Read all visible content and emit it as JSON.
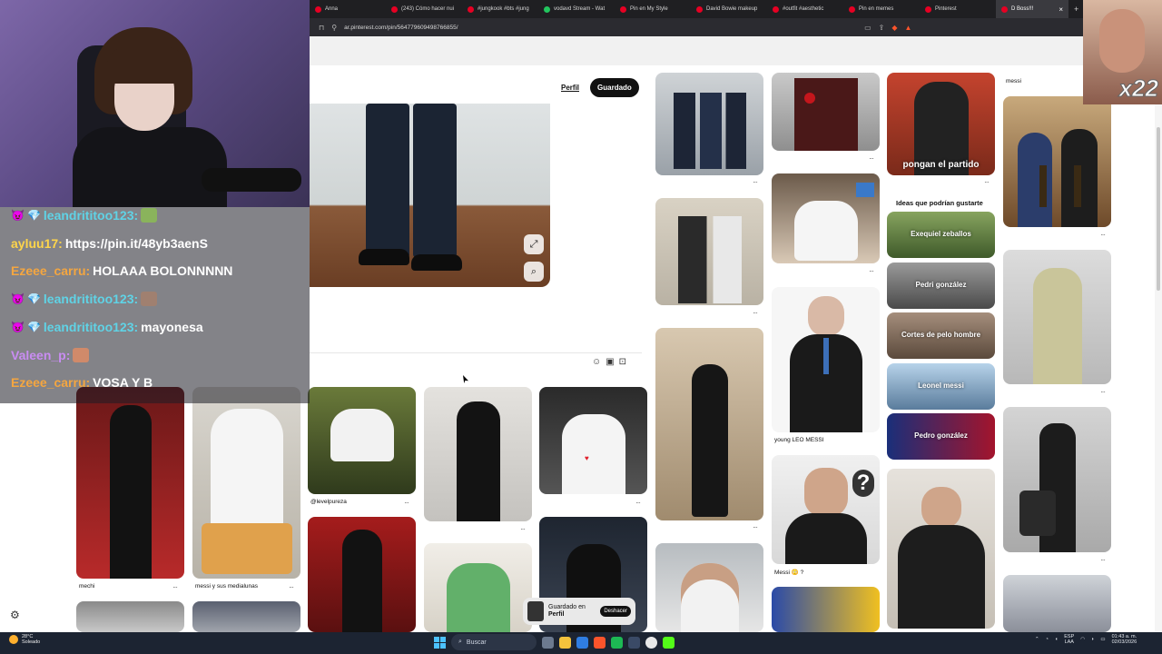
{
  "browser": {
    "tabs": [
      {
        "label": "Anna",
        "active": false,
        "favicon": "pinterest"
      },
      {
        "label": "(243) Cómo hacer nui",
        "active": false,
        "favicon": "pinterest"
      },
      {
        "label": "#jungkook #bts #jung",
        "active": false,
        "favicon": "pinterest"
      },
      {
        "label": "vodavd Stream - Wat",
        "active": false,
        "favicon": "kick"
      },
      {
        "label": "Pin en My Style",
        "active": false,
        "favicon": "pinterest"
      },
      {
        "label": "David Bowie makeup",
        "active": false,
        "favicon": "pinterest"
      },
      {
        "label": "#outfit #aesthetic",
        "active": false,
        "favicon": "pinterest"
      },
      {
        "label": "Pin en memes",
        "active": false,
        "favicon": "pinterest"
      },
      {
        "label": "Pinterest",
        "active": false,
        "favicon": "pinterest"
      },
      {
        "label": "D Boss!!!",
        "active": true,
        "favicon": "pinterest"
      }
    ],
    "close_glyph": "×",
    "new_tab_glyph": "+",
    "url": "ar.pinterest.com/pin/564779609498766855/"
  },
  "pin_detail": {
    "profile_link": "Perfil",
    "saved_button": "Guardado",
    "accent": "#e60023"
  },
  "chat": [
    {
      "user": "leandrititoo123:",
      "message": "",
      "color": "cyan",
      "emote": "green"
    },
    {
      "user": "ayluu17:",
      "message": "https://pin.it/48yb3aenS",
      "color": "yellow",
      "emote": ""
    },
    {
      "user": "Ezeee_carru:",
      "message": "HOLAAA BOLONNNNN",
      "color": "orange",
      "emote": ""
    },
    {
      "user": "leandrititoo123:",
      "message": "",
      "color": "cyan",
      "emote": "brown"
    },
    {
      "user": "leandrititoo123:",
      "message": "mayonesa",
      "color": "cyan",
      "emote": ""
    },
    {
      "user": "Valeen_p:",
      "message": "",
      "color": "purple",
      "emote": "peach"
    },
    {
      "user": "Ezeee_carru:",
      "message": "VOSA Y B",
      "color": "orange",
      "emote": ""
    }
  ],
  "reaction_cam": {
    "label": "x22"
  },
  "grid": {
    "captions": {
      "mechi": "mechi",
      "medialunas": "messi y sus medialunas",
      "levelpureza": "@levelpureza",
      "young_leo": "young LEO MESSI",
      "messi_q": "Messi 😳 ?",
      "messi_top": "messi"
    },
    "section_title": "Ideas que podrían gustarte",
    "overlays": {
      "partido": "pongan el partido",
      "exequiel": "Exequiel zeballos",
      "pedri": "Pedri gonzález",
      "cortes": "Cortes de pelo hombre",
      "leonel": "Leonel messi",
      "pedro": "Pedro gonzález"
    },
    "more_glyph": "···"
  },
  "toast": {
    "line1": "Guardado en",
    "line2": "Perfil",
    "undo": "Deshacer"
  },
  "taskbar": {
    "weather_temp": "28°C",
    "weather_desc": "Soleado",
    "search_placeholder": "Buscar",
    "lang_top": "ESP",
    "lang_bottom": "LAA",
    "time": "01:43 a. m.",
    "date": "02/03/2026"
  }
}
